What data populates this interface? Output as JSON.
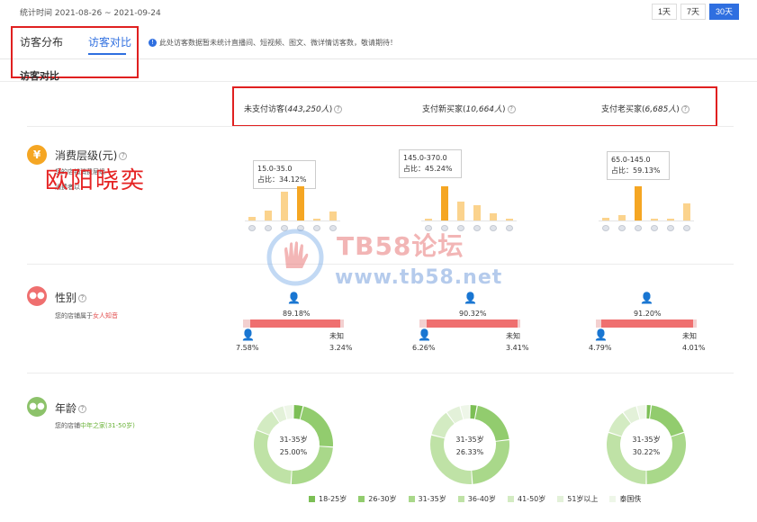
{
  "header": {
    "period": "统计时间 2021-08-26 ~ 2021-09-24",
    "range_buttons": [
      "1天",
      "7天",
      "30天"
    ],
    "active_range": "30天"
  },
  "tabs": [
    {
      "label": "访客分布",
      "active": false
    },
    {
      "label": "访客对比",
      "active": true
    }
  ],
  "notice": "此处访客数据暂未统计直播间、短视频、图文、微详情访客数，敬请期待！",
  "section_title": "访客对比",
  "columns": [
    {
      "label": "未支付访客",
      "count": "443,250人"
    },
    {
      "label": "支付新买家",
      "count": "10,664人"
    },
    {
      "label": "支付老买家",
      "count": "6,685人"
    }
  ],
  "overlay_text": "欧阳晓奕",
  "watermark": {
    "title": "TB58论坛",
    "url": "www.tb58.net"
  },
  "consumption": {
    "label": "消费层级(元)",
    "sub_line1": "您的店铺消费层级",
    "sub_line2": "消费者以",
    "tooltips": [
      {
        "range": "15.0-35.0",
        "ratio": "占比：34.12%"
      },
      {
        "range": "145.0-370.0",
        "ratio": "占比：45.24%"
      },
      {
        "range": "65.0-145.0",
        "ratio": "占比：59.13%"
      }
    ],
    "bars": [
      [
        0.1,
        0.3,
        0.85,
        1.0,
        0.05,
        0.25
      ],
      [
        0.05,
        1.0,
        0.55,
        0.45,
        0.2,
        0.05
      ],
      [
        0.08,
        0.15,
        1.0,
        0.03,
        0.03,
        0.5
      ]
    ],
    "highlight": [
      3,
      1,
      2
    ]
  },
  "gender": {
    "label": "性别",
    "sub_prefix": "您的店铺属于",
    "sub_highlight": "女人知音",
    "groups": [
      {
        "female": "89.18%",
        "male": "7.58%",
        "unknown_label": "未知",
        "unknown": "3.24%",
        "female_share": 0.8918,
        "male_share": 0.0758
      },
      {
        "female": "90.32%",
        "male": "6.26%",
        "unknown_label": "未知",
        "unknown": "3.41%",
        "female_share": 0.9032,
        "male_share": 0.0626
      },
      {
        "female": "91.20%",
        "male": "4.79%",
        "unknown_label": "未知",
        "unknown": "4.01%",
        "female_share": 0.912,
        "male_share": 0.0479
      }
    ]
  },
  "age": {
    "label": "年龄",
    "sub_prefix": "您的店铺",
    "sub_highlight": "中年之家(31-50岁)",
    "donuts": [
      {
        "label": "31-35岁",
        "value": "25.00%",
        "slices": [
          0.04,
          0.22,
          0.25,
          0.3,
          0.1,
          0.05,
          0.04
        ]
      },
      {
        "label": "31-35岁",
        "value": "26.33%",
        "slices": [
          0.03,
          0.2,
          0.26,
          0.3,
          0.11,
          0.06,
          0.04
        ]
      },
      {
        "label": "31-35岁",
        "value": "30.22%",
        "slices": [
          0.02,
          0.18,
          0.3,
          0.3,
          0.1,
          0.06,
          0.04
        ]
      }
    ],
    "legend": [
      {
        "label": "18-25岁",
        "color": "#7cbf55"
      },
      {
        "label": "26-30岁",
        "color": "#92cc6e"
      },
      {
        "label": "31-35岁",
        "color": "#a9d88a"
      },
      {
        "label": "36-40岁",
        "color": "#bfe2a6"
      },
      {
        "label": "41-50岁",
        "color": "#d3ebc2"
      },
      {
        "label": "51岁以上",
        "color": "#e3f1d9"
      },
      {
        "label": "泰国佚",
        "color": "#eef6e8"
      }
    ]
  },
  "colors": {
    "accent": "#2f6fe0",
    "red_frame": "#e02020",
    "consumption_icon": "#f5a623",
    "gender_icon": "#ef6f6f",
    "age_icon": "#8cc26a",
    "bar_main": "#f5a623",
    "bar_light": "#fbd38d"
  }
}
